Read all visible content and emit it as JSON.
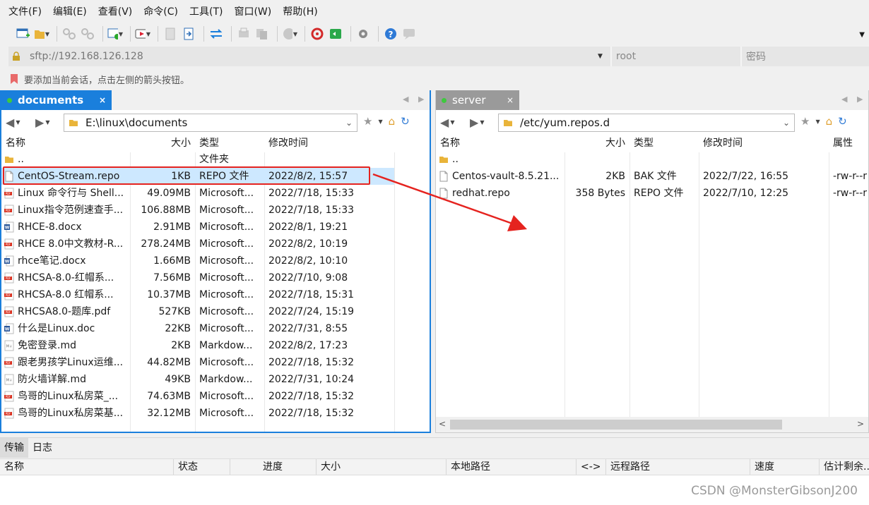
{
  "menu": [
    "文件(F)",
    "编辑(E)",
    "查看(V)",
    "命令(C)",
    "工具(T)",
    "窗口(W)",
    "帮助(H)"
  ],
  "address": {
    "url": "sftp://192.168.126.128",
    "user_placeholder": "root",
    "password_placeholder": "密码"
  },
  "hint": "要添加当前会话，点击左侧的箭头按钮。",
  "left": {
    "tab": "documents",
    "path": "E:\\linux\\documents",
    "columns": [
      "名称",
      "大小",
      "类型",
      "修改时间"
    ],
    "rows": [
      {
        "name": "..",
        "size": "",
        "type": "文件夹",
        "modified": "",
        "icon": "folder-icon"
      },
      {
        "name": "CentOS-Stream.repo",
        "size": "1KB",
        "type": "REPO 文件",
        "modified": "2022/8/2, 15:57",
        "icon": "file-icon"
      },
      {
        "name": "Linux 命令行与 Shell...",
        "size": "49.09MB",
        "type": "Microsoft...",
        "modified": "2022/7/18, 15:33",
        "icon": "pdf-icon"
      },
      {
        "name": "Linux指令范例速查手...",
        "size": "106.88MB",
        "type": "Microsoft...",
        "modified": "2022/7/18, 15:33",
        "icon": "pdf-icon"
      },
      {
        "name": "RHCE-8.docx",
        "size": "2.91MB",
        "type": "Microsoft...",
        "modified": "2022/8/1, 19:21",
        "icon": "word-icon"
      },
      {
        "name": "RHCE 8.0中文教材-R...",
        "size": "278.24MB",
        "type": "Microsoft...",
        "modified": "2022/8/2, 10:19",
        "icon": "pdf-icon"
      },
      {
        "name": "rhce笔记.docx",
        "size": "1.66MB",
        "type": "Microsoft...",
        "modified": "2022/8/2, 10:10",
        "icon": "word-icon"
      },
      {
        "name": "RHCSA-8.0-红帽系...",
        "size": "7.56MB",
        "type": "Microsoft...",
        "modified": "2022/7/10, 9:08",
        "icon": "pdf-icon"
      },
      {
        "name": "RHCSA-8.0 红帽系...",
        "size": "10.37MB",
        "type": "Microsoft...",
        "modified": "2022/7/18, 15:31",
        "icon": "pdf-icon"
      },
      {
        "name": "RHCSA8.0-题库.pdf",
        "size": "527KB",
        "type": "Microsoft...",
        "modified": "2022/7/24, 15:19",
        "icon": "pdf-icon"
      },
      {
        "name": "什么是Linux.doc",
        "size": "22KB",
        "type": "Microsoft...",
        "modified": "2022/7/31, 8:55",
        "icon": "word-icon"
      },
      {
        "name": "免密登录.md",
        "size": "2KB",
        "type": "Markdow...",
        "modified": "2022/8/2, 17:23",
        "icon": "md-icon"
      },
      {
        "name": "跟老男孩学Linux运维...",
        "size": "44.82MB",
        "type": "Microsoft...",
        "modified": "2022/7/18, 15:32",
        "icon": "pdf-icon"
      },
      {
        "name": "防火墙详解.md",
        "size": "49KB",
        "type": "Markdow...",
        "modified": "2022/7/31, 10:24",
        "icon": "md-icon"
      },
      {
        "name": "鸟哥的Linux私房菜_...",
        "size": "74.63MB",
        "type": "Microsoft...",
        "modified": "2022/7/18, 15:32",
        "icon": "pdf-icon"
      },
      {
        "name": "鸟哥的Linux私房菜基...",
        "size": "32.12MB",
        "type": "Microsoft...",
        "modified": "2022/7/18, 15:32",
        "icon": "pdf-icon"
      }
    ]
  },
  "right": {
    "tab": "server",
    "path": "/etc/yum.repos.d",
    "columns": [
      "名称",
      "大小",
      "类型",
      "修改时间",
      "属性"
    ],
    "rows": [
      {
        "name": "..",
        "size": "",
        "type": "",
        "modified": "",
        "attr": "",
        "icon": "folder-icon"
      },
      {
        "name": "Centos-vault-8.5.21...",
        "size": "2KB",
        "type": "BAK 文件",
        "modified": "2022/7/22, 16:55",
        "attr": "-rw-r--r",
        "icon": "file-icon"
      },
      {
        "name": "redhat.repo",
        "size": "358 Bytes",
        "type": "REPO 文件",
        "modified": "2022/7/10, 12:25",
        "attr": "-rw-r--r",
        "icon": "file-icon"
      }
    ]
  },
  "bottom": {
    "tabs": [
      "传输",
      "日志"
    ],
    "columns": [
      "名称",
      "状态",
      "进度",
      "大小",
      "本地路径",
      "<->",
      "远程路径",
      "速度",
      "估计剩余..."
    ]
  },
  "watermark": "CSDN @MonsterGibsonJ200",
  "colors": {
    "accent": "#1a7fdc",
    "selection": "#cde8ff",
    "highlight": "#e5231f"
  }
}
